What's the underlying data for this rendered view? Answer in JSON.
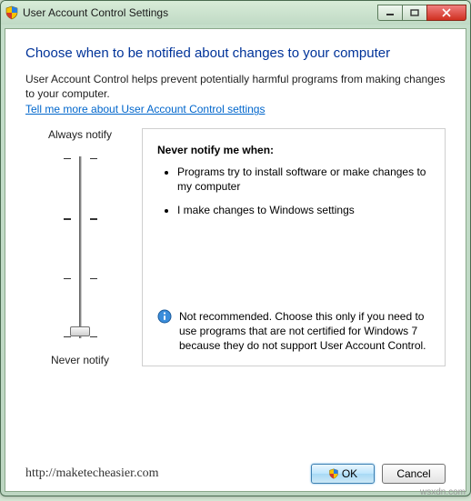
{
  "window": {
    "title": "User Account Control Settings"
  },
  "heading": "Choose when to be notified about changes to your computer",
  "description": "User Account Control helps prevent potentially harmful programs from making changes to your computer.",
  "help_link": "Tell me more about User Account Control settings",
  "slider": {
    "top_label": "Always notify",
    "bottom_label": "Never notify"
  },
  "panel": {
    "title": "Never notify me when:",
    "bullets": [
      "Programs try to install software or make changes to my computer",
      "I make changes to Windows settings"
    ],
    "recommendation": "Not recommended. Choose this only if you need to use programs that are not certified for Windows 7 because they do not support User Account Control."
  },
  "footer": {
    "url": "http://maketecheasier.com",
    "ok": "OK",
    "cancel": "Cancel"
  },
  "watermark": "wsxdn.com"
}
